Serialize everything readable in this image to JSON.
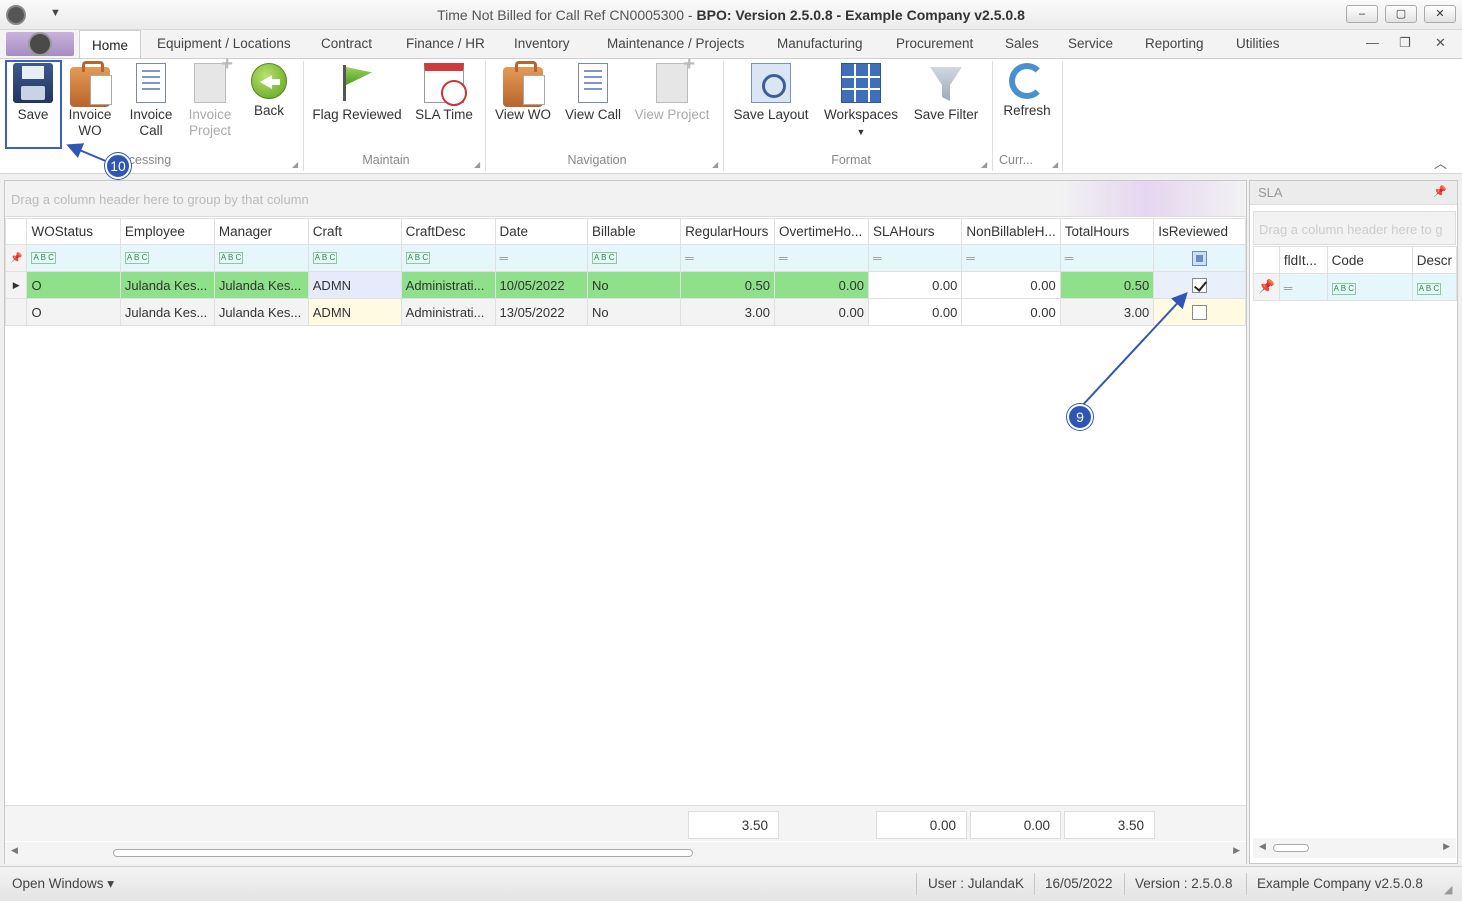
{
  "window": {
    "title_prefix": "Time Not Billed for Call Ref CN0005300 - ",
    "title_bold": "BPO: Version 2.5.0.8 - Example Company v2.5.0.8",
    "min": "–",
    "max": "▢",
    "close": "✕"
  },
  "tabs": [
    "Home",
    "Equipment / Locations",
    "Contract",
    "Finance / HR",
    "Inventory",
    "Maintenance / Projects",
    "Manufacturing",
    "Procurement",
    "Sales",
    "Service",
    "Reporting",
    "Utilities"
  ],
  "ribbon": {
    "save": "Save",
    "invoice_wo_1": "Invoice",
    "invoice_wo_2": "WO",
    "invoice_call_1": "Invoice",
    "invoice_call_2": "Call",
    "invoice_project_1": "Invoice",
    "invoice_project_2": "Project",
    "back": "Back",
    "flag_reviewed": "Flag Reviewed",
    "sla_time": "SLA Time",
    "view_wo": "View WO",
    "view_call": "View Call",
    "view_project": "View Project",
    "save_layout": "Save Layout",
    "workspaces": "Workspaces",
    "save_filter": "Save Filter",
    "refresh": "Refresh",
    "groups": {
      "processing": "cessing",
      "maintain": "Maintain",
      "navigation": "Navigation",
      "format": "Format",
      "current": "Curr..."
    }
  },
  "grid": {
    "group_hint": "Drag a column header here to group by that column",
    "columns": [
      "WOStatus",
      "Employee",
      "Manager",
      "Craft",
      "CraftDesc",
      "Date",
      "Billable",
      "RegularHours",
      "OvertimeHo...",
      "SLAHours",
      "NonBillableH...",
      "TotalHours",
      "IsReviewed"
    ],
    "rows": [
      {
        "wostatus": "O",
        "employee": "Julanda Kes...",
        "manager": "Julanda Kes...",
        "craft": "ADMN",
        "craftdesc": "Administrati...",
        "date": "10/05/2022",
        "billable": "No",
        "regular": "0.50",
        "overtime": "0.00",
        "sla": "0.00",
        "nonbillable": "0.00",
        "total": "0.50",
        "reviewed": true
      },
      {
        "wostatus": "O",
        "employee": "Julanda Kes...",
        "manager": "Julanda Kes...",
        "craft": "ADMN",
        "craftdesc": "Administrati...",
        "date": "13/05/2022",
        "billable": "No",
        "regular": "3.00",
        "overtime": "0.00",
        "sla": "0.00",
        "nonbillable": "0.00",
        "total": "3.00",
        "reviewed": false
      }
    ],
    "totals": {
      "regular": "3.50",
      "sla": "0.00",
      "nonbillable": "0.00",
      "total": "3.50"
    }
  },
  "sla": {
    "title": "SLA",
    "group_hint": "Drag a column header here to g",
    "columns": [
      "fldIt...",
      "Code",
      "Descr"
    ]
  },
  "status": {
    "open_windows": "Open Windows ▾",
    "user": "User : JulandaK",
    "date": "16/05/2022",
    "version": "Version : 2.5.0.8",
    "company": "Example Company v2.5.0.8"
  },
  "callouts": {
    "save_step": "10",
    "reviewed_step": "9"
  },
  "colors": {
    "reviewed_row": "#8fe08a",
    "callout": "#2f56b5",
    "filter_row": "#e6f7fb"
  }
}
